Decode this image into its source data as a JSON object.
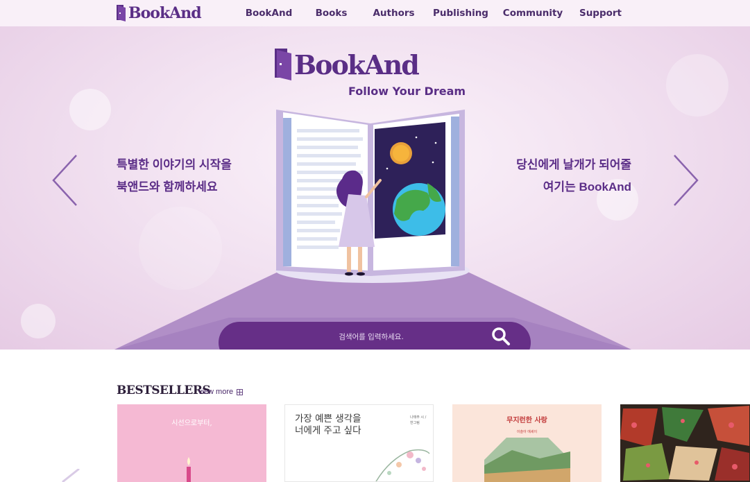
{
  "nav": {
    "logo": "BookAnd",
    "items": [
      "BookAnd",
      "Books",
      "Authors",
      "Publishing",
      "Community",
      "Support"
    ]
  },
  "hero": {
    "logo": "BookAnd",
    "tagline": "Follow Your Dream",
    "left_line1": "특별한 이야기의 시작을",
    "left_line2": "북앤드와 함께하세요",
    "right_line1": "당신에게 날개가 되어줄",
    "right_line2": "여기는 BookAnd"
  },
  "search": {
    "placeholder": "검색어를 입력하세요."
  },
  "bestsellers": {
    "title": "BESTSELLERS",
    "view_more": "view more",
    "books": [
      {
        "title": "시선으로부터,"
      },
      {
        "title_line1": "가장 예쁜 생각을",
        "title_line2": "너에게 주고 싶다",
        "side_text": "나태주 시 / 한그림"
      },
      {
        "title": "무지런한 사랑",
        "subtitle": "이슬아 에세이"
      },
      {
        "title": ""
      }
    ]
  },
  "colors": {
    "brand_purple": "#5a2e86",
    "search_bar": "#662f87",
    "hero_background": "#f2e2f1"
  }
}
